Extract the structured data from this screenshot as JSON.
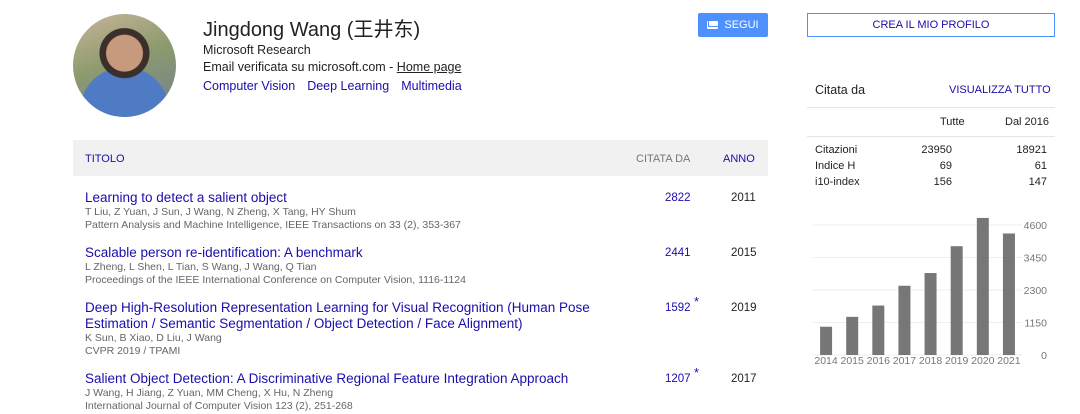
{
  "profile": {
    "name": "Jingdong Wang (王井东)",
    "affiliation": "Microsoft Research",
    "email_text": "Email verificata su microsoft.com - ",
    "homepage_label": "Home page",
    "interests": [
      "Computer Vision",
      "Deep Learning",
      "Multimedia"
    ],
    "follow_label": "SEGUI"
  },
  "table": {
    "col_title": "TITOLO",
    "col_cited": "CITATA DA",
    "col_year": "ANNO",
    "rows": [
      {
        "title": "Learning to detect a salient object",
        "authors": "T Liu, Z Yuan, J Sun, J Wang, N Zheng, X Tang, HY Shum",
        "venue": "Pattern Analysis and Machine Intelligence, IEEE Transactions on 33 (2), 353-367",
        "cited": "2822",
        "star": "",
        "year": "2011"
      },
      {
        "title": "Scalable person re-identification: A benchmark",
        "authors": "L Zheng, L Shen, L Tian, S Wang, J Wang, Q Tian",
        "venue": "Proceedings of the IEEE International Conference on Computer Vision, 1116-1124",
        "cited": "2441",
        "star": "",
        "year": "2015"
      },
      {
        "title": "Deep High-Resolution Representation Learning for Visual Recognition (Human Pose Estimation / Semantic Segmentation / Object Detection / Face Alignment)",
        "authors": "K Sun, B Xiao, D Liu, J Wang",
        "venue": "CVPR 2019 / TPAMI",
        "cited": "1592",
        "star": "*",
        "year": "2019"
      },
      {
        "title": "Salient Object Detection: A Discriminative Regional Feature Integration Approach",
        "authors": "J Wang, H Jiang, Z Yuan, MM Cheng, X Hu, N Zheng",
        "venue": "International Journal of Computer Vision 123 (2), 251-268",
        "cited": "1207",
        "star": "*",
        "year": "2017"
      }
    ]
  },
  "sidebar": {
    "create_profile": "CREA IL MIO PROFILO",
    "cited_by": "Citata da",
    "view_all": "VISUALIZZA TUTTO",
    "col_all": "Tutte",
    "col_since": "Dal 2016",
    "stats": [
      {
        "label": "Citazioni",
        "all": "23950",
        "since": "18921"
      },
      {
        "label": "Indice H",
        "all": "69",
        "since": "61"
      },
      {
        "label": "i10-index",
        "all": "156",
        "since": "147"
      }
    ]
  },
  "chart_data": {
    "type": "bar",
    "categories": [
      "2014",
      "2015",
      "2016",
      "2017",
      "2018",
      "2019",
      "2020",
      "2021"
    ],
    "values": [
      1000,
      1350,
      1750,
      2450,
      2900,
      3850,
      4850,
      4300
    ],
    "yticks": [
      "4600",
      "3450",
      "2300",
      "1150",
      "0"
    ],
    "ylim": [
      0,
      4600
    ],
    "bar_color": "#777777"
  },
  "colors": {
    "link": "#1a0dab",
    "accent": "#4d90fe"
  }
}
